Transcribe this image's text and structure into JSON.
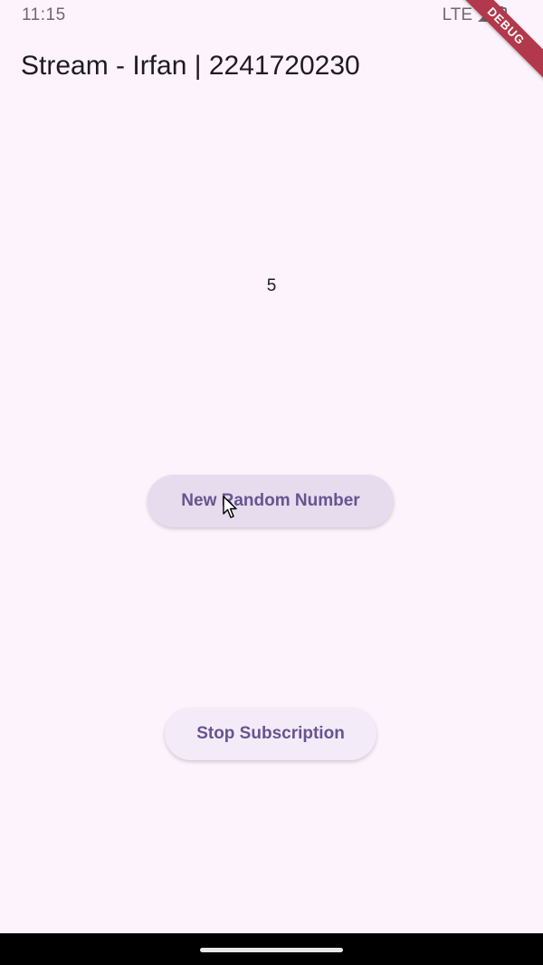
{
  "status_bar": {
    "time": "11:15",
    "network": "LTE",
    "signal_icon": "signal-icon",
    "battery_icon": "battery-icon"
  },
  "debug_banner": {
    "label": "DEBUG"
  },
  "app_bar": {
    "title": "Stream - Irfan | 2241720230"
  },
  "main": {
    "value": "5",
    "new_random_button_label": "New Random Number",
    "stop_button_label": "Stop Subscription"
  },
  "colors": {
    "background": "#fdf3fc",
    "button_text": "#65558f",
    "debug_banner": "#b2394b"
  }
}
